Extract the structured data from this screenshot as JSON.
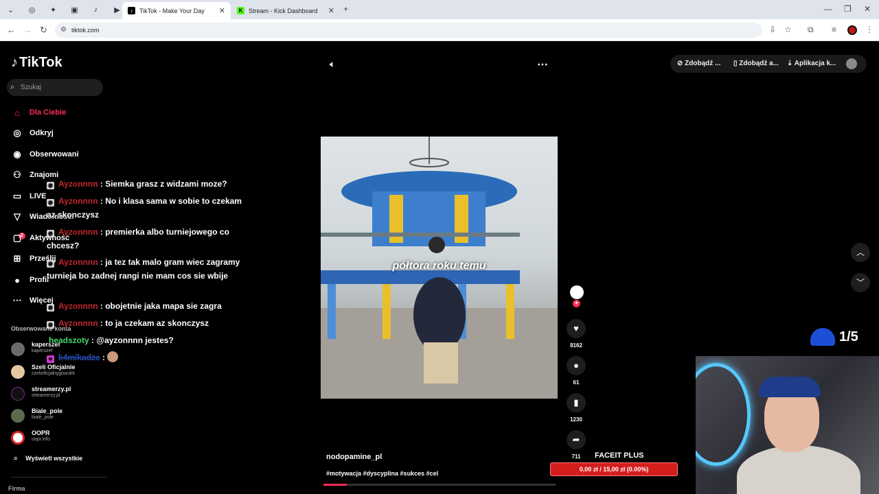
{
  "browser": {
    "tabs": [
      {
        "title": "TikTok - Make Your Day"
      },
      {
        "title": "Stream - Kick Dashboard"
      }
    ],
    "url": "tiktok.com"
  },
  "sidebar": {
    "logo": "TikTok",
    "search_placeholder": "Szukaj",
    "nav": [
      {
        "label": "Dla Ciebie",
        "icon": "home-icon"
      },
      {
        "label": "Odkryj",
        "icon": "compass-icon"
      },
      {
        "label": "Obserwowani",
        "icon": "following-icon"
      },
      {
        "label": "Znajomi",
        "icon": "friends-icon"
      },
      {
        "label": "LIVE",
        "icon": "live-icon"
      },
      {
        "label": "Wiadomości",
        "icon": "messages-icon"
      },
      {
        "label": "Aktywność",
        "icon": "activity-icon"
      },
      {
        "label": "Prześlij",
        "icon": "upload-icon"
      },
      {
        "label": "Profil",
        "icon": "profile-icon"
      },
      {
        "label": "Więcej",
        "icon": "more-icon"
      }
    ],
    "messages_badge": "2",
    "followed_title": "Obserwowane konta",
    "accounts": [
      {
        "name": "kaperszef",
        "handle": "kaperszef"
      },
      {
        "name": "Szeli Oficjalnie",
        "handle": "szelioficjalnygoacikk"
      },
      {
        "name": "streamerzy.pl",
        "handle": "streamerzy.pl"
      },
      {
        "name": "Biale_pole",
        "handle": "biale_pole"
      },
      {
        "name": "OOPR",
        "handle": "oopr.info"
      }
    ],
    "see_all": "Wyświetl wszystkie",
    "footer": "Firma"
  },
  "chat": [
    {
      "user": "Ayzonnnn",
      "text": ": Siemka grasz z widzami moze?"
    },
    {
      "user": "Ayzonnnn",
      "text": ": No i klasa sama w sobie to czekam az skonczysz"
    },
    {
      "user": "Ayzonnnn",
      "text": ": premierka albo turniejowego co chcesz?"
    },
    {
      "user": "Ayzonnnn",
      "text": ": ja tez tak malo gram wiec zagramy turnieja bo zadnej rangi nie mam cos sie wbije"
    },
    {
      "user": "Ayzonnnn",
      "text": ": obojetnie jaka mapa sie zagra"
    },
    {
      "user": "Ayzonnnn",
      "text": ": to ja czekam az skonczysz"
    },
    {
      "user": "headszoty",
      "text": ": @ayzonnnn jestes?"
    },
    {
      "user": "k4mikadze",
      "text": ":"
    }
  ],
  "video": {
    "caption": "półtora roku temu",
    "author": "nodopamine_pl",
    "tags": "#motywacja #dyscyplina #sukces #cel",
    "progress": 0.1,
    "likes": "8162",
    "comments": "61",
    "saves": "1230",
    "shares": "711"
  },
  "top_bar": {
    "btn1": "Zdobądź ...",
    "btn2": "Zdobądź a...",
    "btn3": "Aplikacja k..."
  },
  "overlay": {
    "counter": "1/5",
    "goal_title": "FACEIT PLUS",
    "goal_text": "0,00 zł / 15,00 zł (0.00%)"
  }
}
